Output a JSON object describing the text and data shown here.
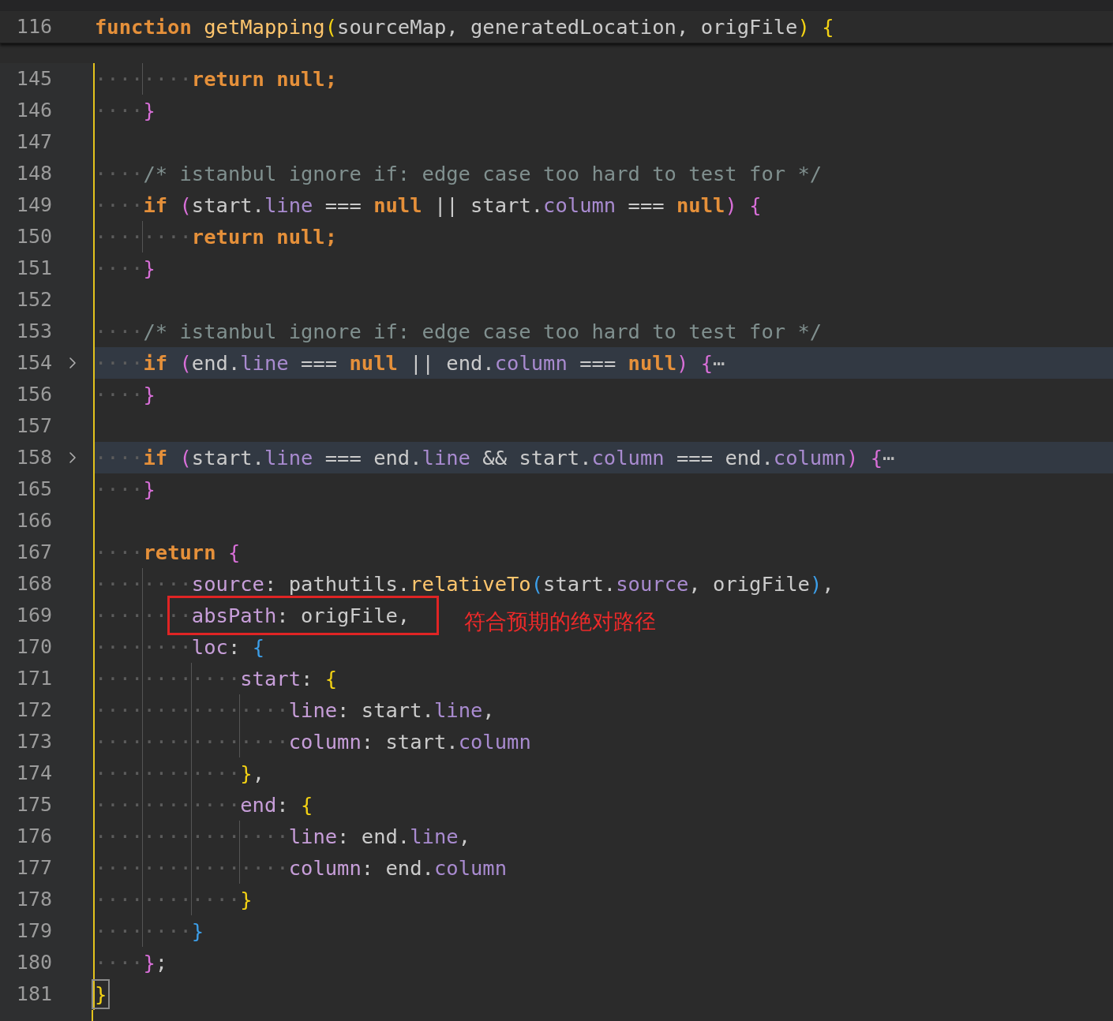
{
  "sticky_line": {
    "num": "116",
    "tokens": [
      {
        "kind": "kw",
        "t": "function "
      },
      {
        "kind": "fn",
        "t": "getMapping"
      },
      {
        "kind": "b1",
        "t": "("
      },
      {
        "kind": "id",
        "t": "sourceMap, generatedLocation, origFile"
      },
      {
        "kind": "b1",
        "t": ") "
      },
      {
        "kind": "b1",
        "t": "{"
      }
    ]
  },
  "lines": [
    {
      "num": "145",
      "folded": false,
      "tokens": [
        {
          "kind": "ws",
          "t": "····"
        },
        {
          "kind": "ws",
          "t": "····"
        },
        {
          "kind": "kw",
          "t": "return null;"
        }
      ]
    },
    {
      "num": "146",
      "folded": false,
      "tokens": [
        {
          "kind": "ws",
          "t": "····"
        },
        {
          "kind": "b2",
          "t": "}"
        }
      ]
    },
    {
      "num": "147",
      "folded": false
    },
    {
      "num": "148",
      "folded": false,
      "tokens": [
        {
          "kind": "ws",
          "t": "····"
        },
        {
          "kind": "cmt",
          "t": "/* istanbul ignore if: edge case too hard to test for */"
        }
      ]
    },
    {
      "num": "149",
      "folded": false,
      "tokens": [
        {
          "kind": "ws",
          "t": "····"
        },
        {
          "kind": "kw",
          "t": "if "
        },
        {
          "kind": "b2",
          "t": "("
        },
        {
          "kind": "id",
          "t": "start."
        },
        {
          "kind": "prop",
          "t": "line"
        },
        {
          "kind": "id",
          "t": " === "
        },
        {
          "kind": "kw",
          "t": "null"
        },
        {
          "kind": "id",
          "t": " || start."
        },
        {
          "kind": "prop",
          "t": "column"
        },
        {
          "kind": "id",
          "t": " === "
        },
        {
          "kind": "kw",
          "t": "null"
        },
        {
          "kind": "b2",
          "t": ") "
        },
        {
          "kind": "b2",
          "t": "{"
        }
      ]
    },
    {
      "num": "150",
      "folded": false,
      "tokens": [
        {
          "kind": "ws",
          "t": "····"
        },
        {
          "kind": "ws",
          "t": "····"
        },
        {
          "kind": "kw",
          "t": "return null;"
        }
      ]
    },
    {
      "num": "151",
      "folded": false,
      "tokens": [
        {
          "kind": "ws",
          "t": "····"
        },
        {
          "kind": "b2",
          "t": "}"
        }
      ]
    },
    {
      "num": "152",
      "folded": false
    },
    {
      "num": "153",
      "folded": false,
      "tokens": [
        {
          "kind": "ws",
          "t": "····"
        },
        {
          "kind": "cmt",
          "t": "/* istanbul ignore if: edge case too hard to test for */"
        }
      ]
    },
    {
      "num": "154",
      "folded": true,
      "tokens": [
        {
          "kind": "ws",
          "t": "····"
        },
        {
          "kind": "kw",
          "t": "if "
        },
        {
          "kind": "b2",
          "t": "("
        },
        {
          "kind": "id",
          "t": "end."
        },
        {
          "kind": "prop",
          "t": "line"
        },
        {
          "kind": "id",
          "t": " === "
        },
        {
          "kind": "kw",
          "t": "null"
        },
        {
          "kind": "id",
          "t": " || end."
        },
        {
          "kind": "prop",
          "t": "column"
        },
        {
          "kind": "id",
          "t": " === "
        },
        {
          "kind": "kw",
          "t": "null"
        },
        {
          "kind": "b2",
          "t": ") "
        },
        {
          "kind": "b2",
          "t": "{"
        },
        {
          "kind": "fold",
          "t": "⋯"
        }
      ]
    },
    {
      "num": "156",
      "folded": false,
      "tokens": [
        {
          "kind": "ws",
          "t": "····"
        },
        {
          "kind": "b2",
          "t": "}"
        }
      ]
    },
    {
      "num": "157",
      "folded": false
    },
    {
      "num": "158",
      "folded": true,
      "tokens": [
        {
          "kind": "ws",
          "t": "····"
        },
        {
          "kind": "kw",
          "t": "if "
        },
        {
          "kind": "b2",
          "t": "("
        },
        {
          "kind": "id",
          "t": "start."
        },
        {
          "kind": "prop",
          "t": "line"
        },
        {
          "kind": "id",
          "t": " === end."
        },
        {
          "kind": "prop",
          "t": "line"
        },
        {
          "kind": "id",
          "t": " && start."
        },
        {
          "kind": "prop",
          "t": "column"
        },
        {
          "kind": "id",
          "t": " === end."
        },
        {
          "kind": "prop",
          "t": "column"
        },
        {
          "kind": "b2",
          "t": ") "
        },
        {
          "kind": "b2",
          "t": "{"
        },
        {
          "kind": "fold",
          "t": "⋯"
        }
      ]
    },
    {
      "num": "165",
      "folded": false,
      "tokens": [
        {
          "kind": "ws",
          "t": "····"
        },
        {
          "kind": "b2",
          "t": "}"
        }
      ]
    },
    {
      "num": "166",
      "folded": false
    },
    {
      "num": "167",
      "folded": false,
      "tokens": [
        {
          "kind": "ws",
          "t": "····"
        },
        {
          "kind": "kw",
          "t": "return "
        },
        {
          "kind": "b2",
          "t": "{"
        }
      ]
    },
    {
      "num": "168",
      "folded": false,
      "tokens": [
        {
          "kind": "ws",
          "t": "····"
        },
        {
          "kind": "ws",
          "t": "····"
        },
        {
          "kind": "key",
          "t": "source"
        },
        {
          "kind": "id",
          "t": ": pathutils."
        },
        {
          "kind": "fn",
          "t": "relativeTo"
        },
        {
          "kind": "b3",
          "t": "("
        },
        {
          "kind": "id",
          "t": "start."
        },
        {
          "kind": "prop",
          "t": "source"
        },
        {
          "kind": "id",
          "t": ", origFile"
        },
        {
          "kind": "b3",
          "t": ")"
        },
        {
          "kind": "id",
          "t": ","
        }
      ]
    },
    {
      "num": "169",
      "folded": false,
      "annotation": "符合预期的绝对路径",
      "tokens": [
        {
          "kind": "ws",
          "t": "····"
        },
        {
          "kind": "ws",
          "t": "····"
        },
        {
          "kind": "key",
          "t": "absPath"
        },
        {
          "kind": "id",
          "t": ": origFile,"
        }
      ]
    },
    {
      "num": "170",
      "folded": false,
      "tokens": [
        {
          "kind": "ws",
          "t": "····"
        },
        {
          "kind": "ws",
          "t": "····"
        },
        {
          "kind": "key",
          "t": "loc"
        },
        {
          "kind": "id",
          "t": ": "
        },
        {
          "kind": "b3",
          "t": "{"
        }
      ]
    },
    {
      "num": "171",
      "folded": false,
      "tokens": [
        {
          "kind": "ws",
          "t": "····"
        },
        {
          "kind": "ws",
          "t": "····"
        },
        {
          "kind": "ws",
          "t": "····"
        },
        {
          "kind": "key",
          "t": "start"
        },
        {
          "kind": "id",
          "t": ": "
        },
        {
          "kind": "b1",
          "t": "{"
        }
      ]
    },
    {
      "num": "172",
      "folded": false,
      "tokens": [
        {
          "kind": "ws",
          "t": "····"
        },
        {
          "kind": "ws",
          "t": "····"
        },
        {
          "kind": "ws",
          "t": "····"
        },
        {
          "kind": "ws",
          "t": "····"
        },
        {
          "kind": "key",
          "t": "line"
        },
        {
          "kind": "id",
          "t": ": start."
        },
        {
          "kind": "prop",
          "t": "line"
        },
        {
          "kind": "id",
          "t": ","
        }
      ]
    },
    {
      "num": "173",
      "folded": false,
      "tokens": [
        {
          "kind": "ws",
          "t": "····"
        },
        {
          "kind": "ws",
          "t": "····"
        },
        {
          "kind": "ws",
          "t": "····"
        },
        {
          "kind": "ws",
          "t": "····"
        },
        {
          "kind": "key",
          "t": "column"
        },
        {
          "kind": "id",
          "t": ": start."
        },
        {
          "kind": "prop",
          "t": "column"
        }
      ]
    },
    {
      "num": "174",
      "folded": false,
      "tokens": [
        {
          "kind": "ws",
          "t": "····"
        },
        {
          "kind": "ws",
          "t": "····"
        },
        {
          "kind": "ws",
          "t": "····"
        },
        {
          "kind": "b1",
          "t": "}"
        },
        {
          "kind": "id",
          "t": ","
        }
      ]
    },
    {
      "num": "175",
      "folded": false,
      "tokens": [
        {
          "kind": "ws",
          "t": "····"
        },
        {
          "kind": "ws",
          "t": "····"
        },
        {
          "kind": "ws",
          "t": "····"
        },
        {
          "kind": "key",
          "t": "end"
        },
        {
          "kind": "id",
          "t": ": "
        },
        {
          "kind": "b1",
          "t": "{"
        }
      ]
    },
    {
      "num": "176",
      "folded": false,
      "tokens": [
        {
          "kind": "ws",
          "t": "····"
        },
        {
          "kind": "ws",
          "t": "····"
        },
        {
          "kind": "ws",
          "t": "····"
        },
        {
          "kind": "ws",
          "t": "····"
        },
        {
          "kind": "key",
          "t": "line"
        },
        {
          "kind": "id",
          "t": ": end."
        },
        {
          "kind": "prop",
          "t": "line"
        },
        {
          "kind": "id",
          "t": ","
        }
      ]
    },
    {
      "num": "177",
      "folded": false,
      "tokens": [
        {
          "kind": "ws",
          "t": "····"
        },
        {
          "kind": "ws",
          "t": "····"
        },
        {
          "kind": "ws",
          "t": "····"
        },
        {
          "kind": "ws",
          "t": "····"
        },
        {
          "kind": "key",
          "t": "column"
        },
        {
          "kind": "id",
          "t": ": end."
        },
        {
          "kind": "prop",
          "t": "column"
        }
      ]
    },
    {
      "num": "178",
      "folded": false,
      "tokens": [
        {
          "kind": "ws",
          "t": "····"
        },
        {
          "kind": "ws",
          "t": "····"
        },
        {
          "kind": "ws",
          "t": "····"
        },
        {
          "kind": "b1",
          "t": "}"
        }
      ]
    },
    {
      "num": "179",
      "folded": false,
      "tokens": [
        {
          "kind": "ws",
          "t": "····"
        },
        {
          "kind": "ws",
          "t": "····"
        },
        {
          "kind": "b3",
          "t": "}"
        }
      ]
    },
    {
      "num": "180",
      "folded": false,
      "tokens": [
        {
          "kind": "ws",
          "t": "····"
        },
        {
          "kind": "b2",
          "t": "}"
        },
        {
          "kind": "id",
          "t": ";"
        }
      ]
    },
    {
      "num": "181",
      "folded": false,
      "tokens": [
        {
          "kind": "bm",
          "t": "}"
        }
      ]
    }
  ]
}
